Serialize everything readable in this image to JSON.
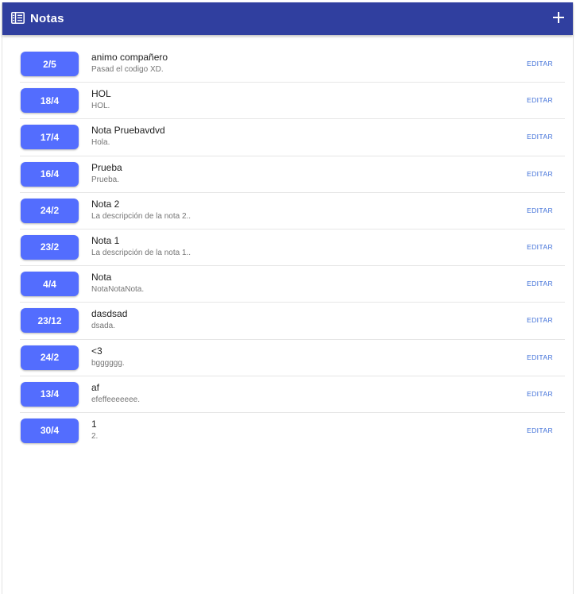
{
  "appbar": {
    "title": "Notas",
    "menu_icon": "notebook-icon",
    "add_icon": "plus-icon",
    "color": "#303f9f"
  },
  "accent": "#536dfe",
  "link_color": "#3f6fd8",
  "notes": [
    {
      "date": "2/5",
      "title": "animo compañero",
      "description": "Pasad el codigo XD.",
      "action": "EDITAR"
    },
    {
      "date": "18/4",
      "title": "HOL",
      "description": "HOL.",
      "action": "EDITAR"
    },
    {
      "date": "17/4",
      "title": "Nota Pruebavdvd",
      "description": "Hola.",
      "action": "EDITAR"
    },
    {
      "date": "16/4",
      "title": "Prueba",
      "description": "Prueba.",
      "action": "EDITAR"
    },
    {
      "date": "24/2",
      "title": "Nota 2",
      "description": "La descripción de la nota 2..",
      "action": "EDITAR"
    },
    {
      "date": "23/2",
      "title": "Nota 1",
      "description": "La descripción de la nota 1..",
      "action": "EDITAR"
    },
    {
      "date": "4/4",
      "title": "Nota",
      "description": "NotaNotaNota.",
      "action": "EDITAR"
    },
    {
      "date": "23/12",
      "title": "dasdsad",
      "description": "dsada.",
      "action": "EDITAR"
    },
    {
      "date": "24/2",
      "title": "<3",
      "description": "bgggggg.",
      "action": "EDITAR"
    },
    {
      "date": "13/4",
      "title": "af",
      "description": "efeffeeeeeee.",
      "action": "EDITAR"
    },
    {
      "date": "30/4",
      "title": "1",
      "description": "2.",
      "action": "EDITAR"
    }
  ]
}
